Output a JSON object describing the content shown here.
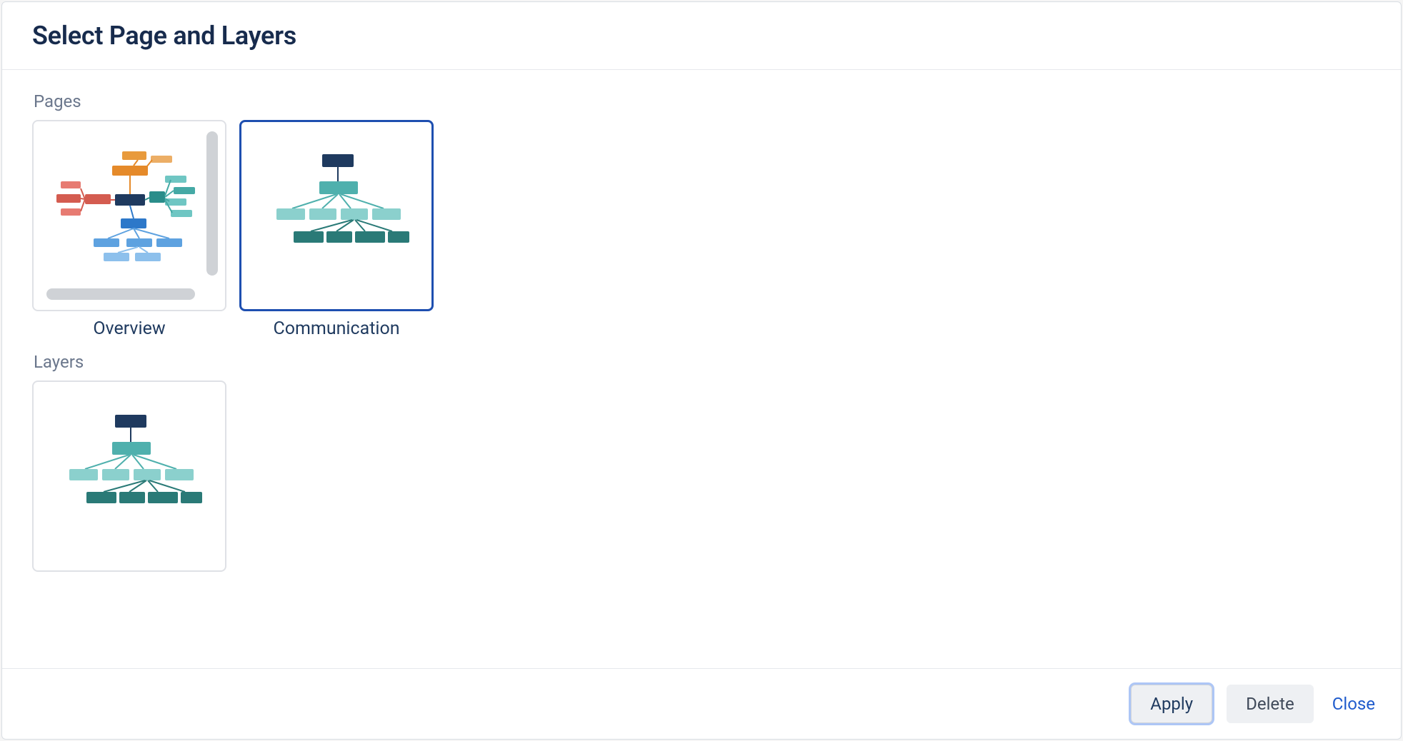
{
  "dialog": {
    "title": "Select Page and Layers"
  },
  "sections": {
    "pages_label": "Pages",
    "layers_label": "Layers"
  },
  "pages": [
    {
      "label": "Overview",
      "selected": false
    },
    {
      "label": "Communication",
      "selected": true
    }
  ],
  "layers": [
    {
      "label": "",
      "selected": false
    }
  ],
  "footer": {
    "apply_label": "Apply",
    "delete_label": "Delete",
    "close_label": "Close"
  }
}
